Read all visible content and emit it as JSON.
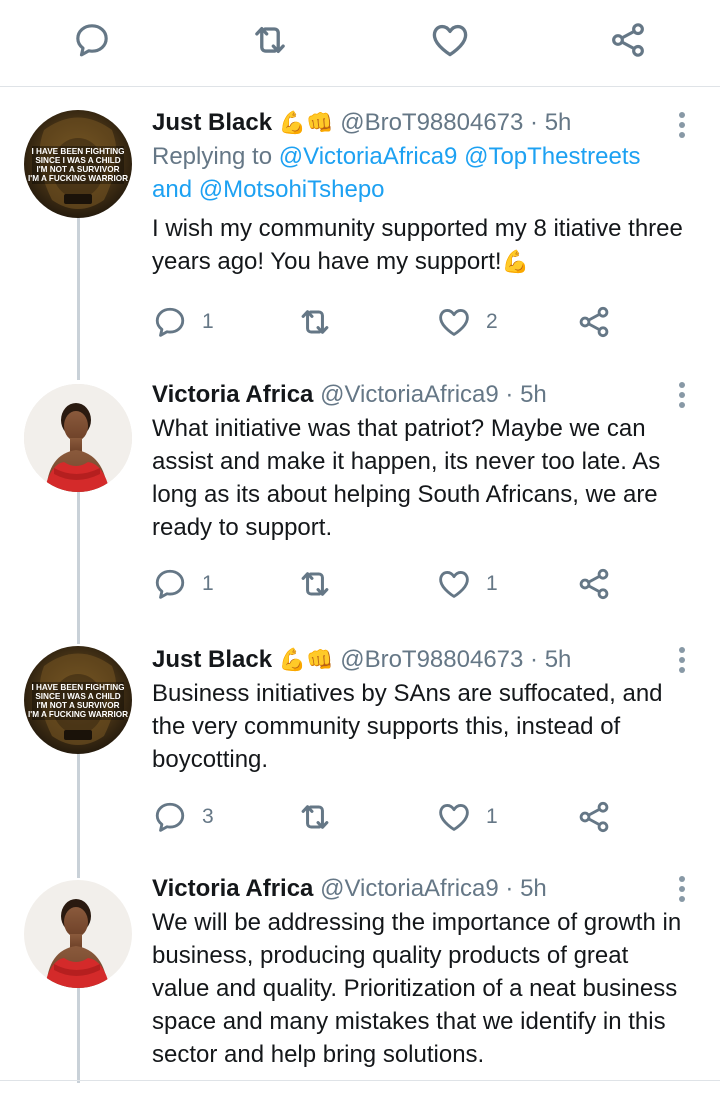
{
  "colors": {
    "accent": "#1da1f2",
    "secondary_text": "#657786",
    "icon": "#657786",
    "thread_line": "#c9d1d8"
  },
  "top_actions": {
    "icons": [
      "reply-icon",
      "retweet-icon",
      "like-icon",
      "share-icon"
    ]
  },
  "tweets": [
    {
      "display_name": "Just Black",
      "emoji": "💪👊",
      "handle": "@BroT98804673",
      "time": "· 5h",
      "replying_to_prefix": "Replying to",
      "replying_to": [
        "@VictoriaAfrica9",
        "@TopThestreets"
      ],
      "replying_to_and": "and",
      "replying_to_last": "@MotsohiTshepo",
      "text": "I wish my community supported my 8 itiative three years ago! You have my support!",
      "text_emoji": "💪",
      "counts": {
        "replies": "1",
        "retweets": "",
        "likes": "2"
      },
      "avatar_text": [
        "I HAVE BEEN FIGHTING",
        "SINCE I WAS A CHILD",
        "I'M NOT A SURVIVOR",
        "I'M A FUCKING WARRIOR"
      ]
    },
    {
      "display_name": "Victoria Africa",
      "handle": "@VictoriaAfrica9",
      "time": "· 5h",
      "text": "What initiative was that patriot? Maybe we can assist and make it happen, its never too late. As long as its about helping South Africans, we are ready to support.",
      "counts": {
        "replies": "1",
        "retweets": "",
        "likes": "1"
      }
    },
    {
      "display_name": "Just Black",
      "emoji": "💪👊",
      "handle": "@BroT98804673",
      "time": "· 5h",
      "text": "Business initiatives by SAns are suffocated, and the very community supports this, instead of boycotting.",
      "counts": {
        "replies": "3",
        "retweets": "",
        "likes": "1"
      },
      "avatar_text": [
        "I HAVE BEEN FIGHTING",
        "SINCE I WAS A CHILD",
        "I'M NOT A SURVIVOR",
        "I'M A FUCKING WARRIOR"
      ]
    },
    {
      "display_name": "Victoria Africa",
      "handle": "@VictoriaAfrica9",
      "time": "· 5h",
      "text": "We will be addressing the importance of growth in business, producing quality products of great value and quality. Prioritization of a neat business space and many mistakes that we identify in this sector and help bring solutions."
    }
  ]
}
